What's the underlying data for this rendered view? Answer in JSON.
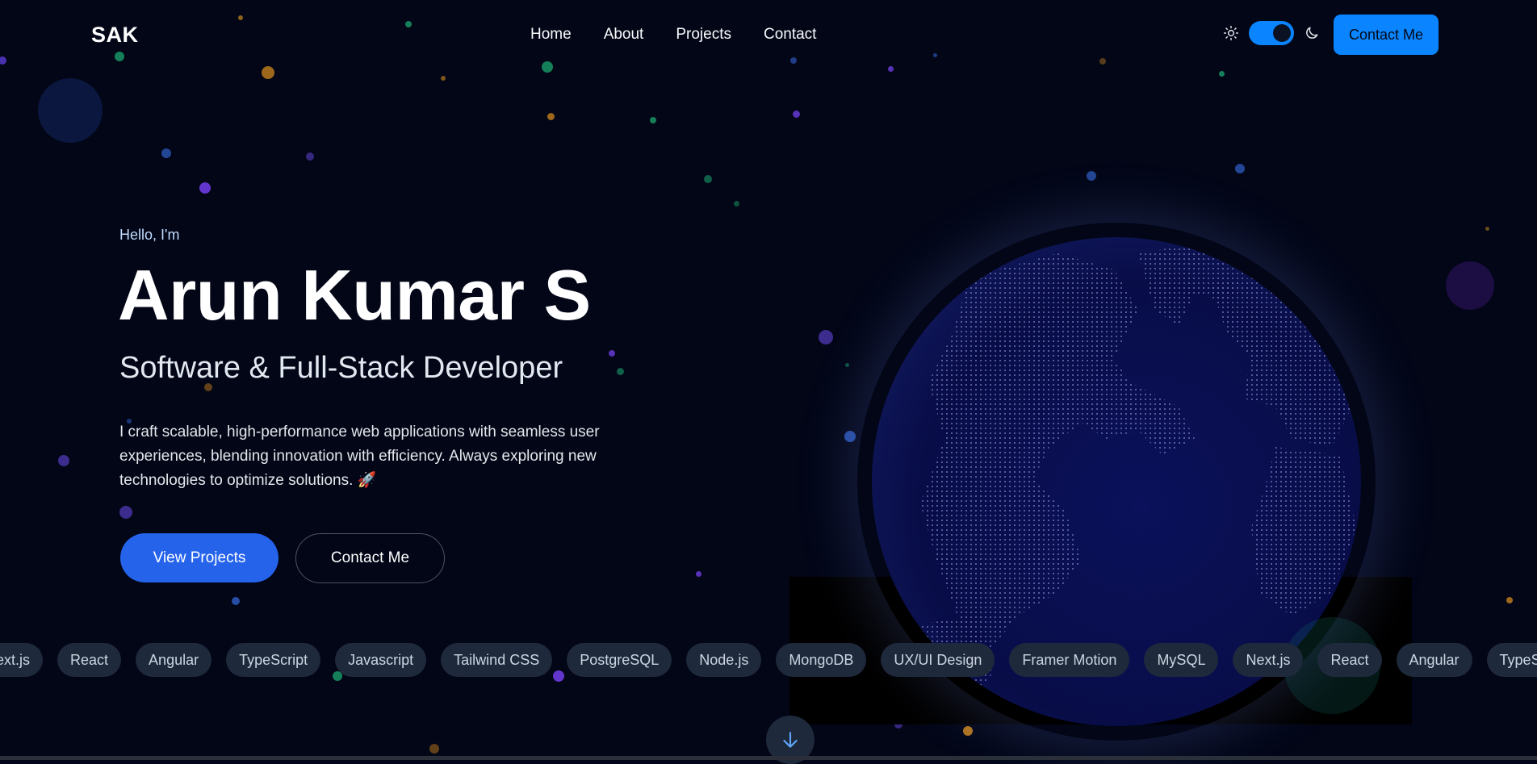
{
  "header": {
    "logo": "SAK",
    "nav": [
      "Home",
      "About",
      "Projects",
      "Contact"
    ],
    "theme_icons": {
      "light": "sun-icon",
      "dark": "moon-icon"
    },
    "theme_toggle": "dark",
    "contact_button": "Contact Me"
  },
  "hero": {
    "greeting": "Hello, I'm",
    "name": "Arun Kumar S",
    "role": "Software & Full-Stack Developer",
    "description": "I craft scalable, high-performance web applications with seamless user experiences, blending innovation with efficiency. Always exploring new technologies to optimize solutions. 🚀",
    "primary_button": "View Projects",
    "secondary_button": "Contact Me"
  },
  "tech_strip": [
    "Next.js",
    "React",
    "Angular",
    "TypeScript",
    "Javascript",
    "Tailwind CSS",
    "PostgreSQL",
    "Node.js",
    "MongoDB",
    "UX/UI Design",
    "Framer Motion",
    "MySQL",
    "Next.js",
    "React",
    "Angular",
    "TypeScript"
  ],
  "scroll_icon": "arrow-down-icon",
  "colors": {
    "background": "#020617",
    "accent": "#0a84ff",
    "primary_button": "#2563eb",
    "chip": "#1e293b",
    "globe": "#0a0f52"
  }
}
